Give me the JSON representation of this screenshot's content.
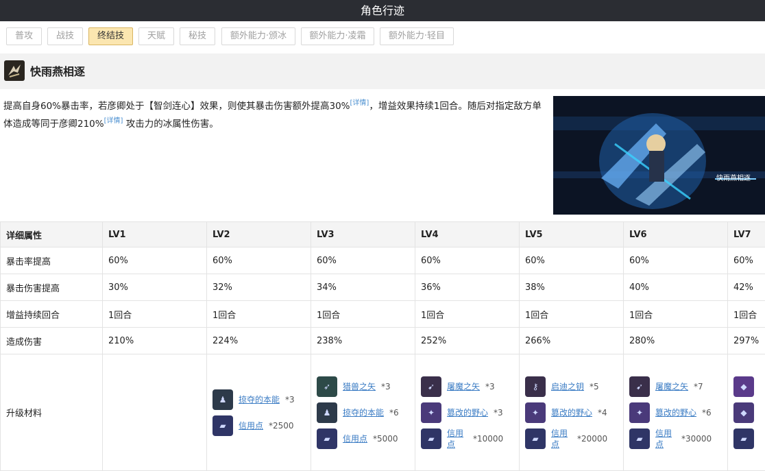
{
  "page_title": "角色行迹",
  "tabs": [
    {
      "label": "普攻",
      "active": false
    },
    {
      "label": "战技",
      "active": false
    },
    {
      "label": "终结技",
      "active": true
    },
    {
      "label": "天赋",
      "active": false
    },
    {
      "label": "秘技",
      "active": false
    },
    {
      "label": "额外能力·颁冰",
      "active": false
    },
    {
      "label": "额外能力·凌霜",
      "active": false
    },
    {
      "label": "额外能力·轻目",
      "active": false
    }
  ],
  "skill": {
    "name": "快雨燕相逐",
    "desc_part1": "提高自身60%暴击率，若彦卿处于【智剑连心】效果，则使其暴击伤害额外提高30%",
    "detail_link": "[详情]",
    "desc_part2": "，增益效果持续1回合。随后对指定敌方单体造成等同于彦卿210%",
    "desc_part3": "攻击力的冰属性伤害。",
    "preview_label": "快雨燕相逐"
  },
  "table": {
    "header": [
      "详细属性",
      "LV1",
      "LV2",
      "LV3",
      "LV4",
      "LV5",
      "LV6",
      "LV7"
    ],
    "rows": [
      {
        "label": "暴击率提高",
        "values": [
          "60%",
          "60%",
          "60%",
          "60%",
          "60%",
          "60%",
          "60%"
        ]
      },
      {
        "label": "暴击伤害提高",
        "values": [
          "30%",
          "32%",
          "34%",
          "36%",
          "38%",
          "40%",
          "42%"
        ]
      },
      {
        "label": "增益持续回合",
        "values": [
          "1回合",
          "1回合",
          "1回合",
          "1回合",
          "1回合",
          "1回合",
          "1回合"
        ]
      },
      {
        "label": "造成伤害",
        "values": [
          "210%",
          "224%",
          "238%",
          "252%",
          "266%",
          "280%",
          "297%"
        ]
      }
    ],
    "materials_label": "升级材料",
    "materials": [
      [],
      [
        {
          "name": "掠夺的本能",
          "count": "*3",
          "icon": "instinct-icon",
          "color": "#2d3a4a"
        },
        {
          "name": "信用点",
          "count": "*2500",
          "icon": "credit-icon",
          "color": "#2f3566"
        }
      ],
      [
        {
          "name": "猎兽之矢",
          "count": "*3",
          "icon": "arrow-icon",
          "color": "#2d4a48"
        },
        {
          "name": "掠夺的本能",
          "count": "*6",
          "icon": "instinct-icon",
          "color": "#2d3a4a"
        },
        {
          "name": "信用点",
          "count": "*5000",
          "icon": "credit-icon",
          "color": "#2f3566"
        }
      ],
      [
        {
          "name": "屠魔之矢",
          "count": "*3",
          "icon": "red-arrow-icon",
          "color": "#3a2f4a"
        },
        {
          "name": "篡改的野心",
          "count": "*3",
          "icon": "ambition-icon",
          "color": "#4a3a7a"
        },
        {
          "name": "信用点",
          "count": "*10000",
          "icon": "credit-icon",
          "color": "#2f3566"
        }
      ],
      [
        {
          "name": "启迪之钥",
          "count": "*5",
          "icon": "key-icon",
          "color": "#3a2f4a"
        },
        {
          "name": "篡改的野心",
          "count": "*4",
          "icon": "ambition-icon",
          "color": "#4a3a7a"
        },
        {
          "name": "信用点",
          "count": "*20000",
          "icon": "credit-icon",
          "color": "#2f3566"
        }
      ],
      [
        {
          "name": "屠魔之矢",
          "count": "*7",
          "icon": "red-arrow-icon",
          "color": "#3a2f4a"
        },
        {
          "name": "篡改的野心",
          "count": "*6",
          "icon": "ambition-icon",
          "color": "#4a3a7a"
        },
        {
          "name": "信用点",
          "count": "*30000",
          "icon": "credit-icon",
          "color": "#2f3566"
        }
      ],
      [
        {
          "name": "",
          "count": "",
          "icon": "purple-item-icon",
          "color": "#5a3a8a"
        },
        {
          "name": "",
          "count": "",
          "icon": "purple-item-icon",
          "color": "#4a3a7a"
        },
        {
          "name": "",
          "count": "",
          "icon": "credit-icon",
          "color": "#2f3566"
        }
      ]
    ]
  }
}
